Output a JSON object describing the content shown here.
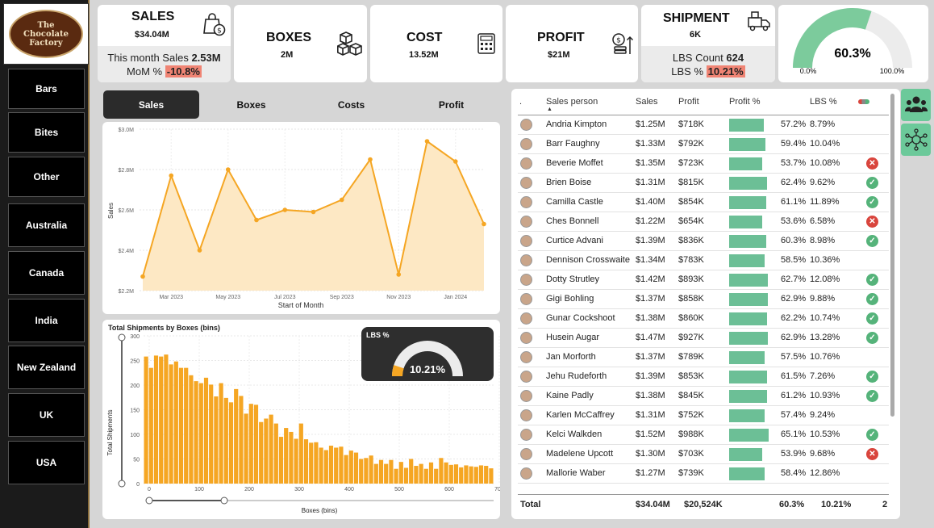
{
  "logo": {
    "line1": "The",
    "line2": "Chocolate",
    "line3": "Factory"
  },
  "nav": [
    "Bars",
    "Bites",
    "Other",
    "Australia",
    "Canada",
    "India",
    "New Zealand",
    "UK",
    "USA"
  ],
  "kpi": {
    "sales": {
      "title": "SALES",
      "value": "$34.04M",
      "month_label": "This month Sales",
      "month_value": "2.53M",
      "mom_label": "MoM %",
      "mom_value": "-10.8%"
    },
    "boxes": {
      "title": "BOXES",
      "value": "2M"
    },
    "cost": {
      "title": "COST",
      "value": "13.52M"
    },
    "profit": {
      "title": "PROFIT",
      "value": "$21M"
    },
    "shipment": {
      "title": "SHIPMENT",
      "value": "6K",
      "lbs_count_label": "LBS Count",
      "lbs_count_value": "624",
      "lbs_pct_label": "LBS %",
      "lbs_pct_value": "10.21%"
    },
    "gauge": {
      "value": "60.3%",
      "min": "0.0%",
      "max": "100.0%",
      "fraction": 0.603
    }
  },
  "tabs": [
    "Sales",
    "Boxes",
    "Costs",
    "Profit"
  ],
  "colors": {
    "accent": "#f5a623",
    "area": "#fde8c4",
    "green": "#6cbf96",
    "red": "#f08474"
  },
  "chart_data": [
    {
      "type": "area",
      "xlabel": "Start of Month",
      "ylabel": "Sales",
      "ylim": [
        2.2,
        3.0
      ],
      "y_ticks": [
        "$2.2M",
        "$2.4M",
        "$2.6M",
        "$2.8M",
        "$3.0M"
      ],
      "x_ticks": [
        "Mar 2023",
        "May 2023",
        "Jul 2023",
        "Sep 2023",
        "Nov 2023",
        "Jan 2024"
      ],
      "x": [
        "Feb 2023",
        "Mar 2023",
        "Apr 2023",
        "May 2023",
        "Jun 2023",
        "Jul 2023",
        "Aug 2023",
        "Sep 2023",
        "Oct 2023",
        "Nov 2023",
        "Dec 2023",
        "Jan 2024",
        "Feb 2024"
      ],
      "values": [
        2.27,
        2.77,
        2.4,
        2.8,
        2.55,
        2.6,
        2.59,
        2.65,
        2.85,
        2.28,
        2.94,
        2.84,
        2.53
      ]
    },
    {
      "type": "bar",
      "title": "Total Shipments by Boxes (bins)",
      "xlabel": "Boxes (bins)",
      "ylabel": "Total Shipments",
      "ylim": [
        0,
        300
      ],
      "y_ticks": [
        "0",
        "50",
        "100",
        "150",
        "200",
        "250",
        "300"
      ],
      "x_ticks": [
        "0",
        "100",
        "200",
        "300",
        "400",
        "500",
        "600",
        "700"
      ],
      "bin_width": 10,
      "values": [
        258,
        235,
        260,
        258,
        262,
        242,
        248,
        235,
        235,
        220,
        208,
        204,
        215,
        201,
        177,
        204,
        174,
        165,
        192,
        178,
        142,
        162,
        160,
        125,
        132,
        140,
        122,
        95,
        113,
        105,
        91,
        122,
        90,
        83,
        84,
        73,
        68,
        77,
        73,
        75,
        58,
        67,
        63,
        50,
        52,
        57,
        40,
        48,
        40,
        48,
        30,
        44,
        32,
        50,
        36,
        40,
        30,
        43,
        30,
        52,
        43,
        38,
        39,
        33,
        37,
        35,
        34,
        37,
        36,
        31
      ]
    },
    {
      "type": "gauge",
      "title": "LBS %",
      "value": "10.21%",
      "fraction": 0.1021
    }
  ],
  "table": {
    "headers": {
      "sales_person": "Sales person",
      "sales": "Sales",
      "profit": "Profit",
      "profit_pct": "Profit %",
      "lbs_pct": "LBS %"
    },
    "rows": [
      {
        "name": "Andria Kimpton",
        "sales": "$1.25M",
        "profit": "$718K",
        "profit_pct": "57.2%",
        "pct": 0.572,
        "lbs": "8.79%",
        "status": ""
      },
      {
        "name": "Barr Faughny",
        "sales": "$1.33M",
        "profit": "$792K",
        "profit_pct": "59.4%",
        "pct": 0.594,
        "lbs": "10.04%",
        "status": ""
      },
      {
        "name": "Beverie Moffet",
        "sales": "$1.35M",
        "profit": "$723K",
        "profit_pct": "53.7%",
        "pct": 0.537,
        "lbs": "10.08%",
        "status": "bad"
      },
      {
        "name": "Brien Boise",
        "sales": "$1.31M",
        "profit": "$815K",
        "profit_pct": "62.4%",
        "pct": 0.624,
        "lbs": "9.62%",
        "status": "ok"
      },
      {
        "name": "Camilla Castle",
        "sales": "$1.40M",
        "profit": "$854K",
        "profit_pct": "61.1%",
        "pct": 0.611,
        "lbs": "11.89%",
        "status": "ok"
      },
      {
        "name": "Ches Bonnell",
        "sales": "$1.22M",
        "profit": "$654K",
        "profit_pct": "53.6%",
        "pct": 0.536,
        "lbs": "6.58%",
        "status": "bad"
      },
      {
        "name": "Curtice Advani",
        "sales": "$1.39M",
        "profit": "$836K",
        "profit_pct": "60.3%",
        "pct": 0.603,
        "lbs": "8.98%",
        "status": "ok"
      },
      {
        "name": "Dennison Crosswaite",
        "sales": "$1.34M",
        "profit": "$783K",
        "profit_pct": "58.5%",
        "pct": 0.585,
        "lbs": "10.36%",
        "status": ""
      },
      {
        "name": "Dotty Strutley",
        "sales": "$1.42M",
        "profit": "$893K",
        "profit_pct": "62.7%",
        "pct": 0.627,
        "lbs": "12.08%",
        "status": "ok"
      },
      {
        "name": "Gigi Bohling",
        "sales": "$1.37M",
        "profit": "$858K",
        "profit_pct": "62.9%",
        "pct": 0.629,
        "lbs": "9.88%",
        "status": "ok"
      },
      {
        "name": "Gunar Cockshoot",
        "sales": "$1.38M",
        "profit": "$860K",
        "profit_pct": "62.2%",
        "pct": 0.622,
        "lbs": "10.74%",
        "status": "ok"
      },
      {
        "name": "Husein Augar",
        "sales": "$1.47M",
        "profit": "$927K",
        "profit_pct": "62.9%",
        "pct": 0.629,
        "lbs": "13.28%",
        "status": "ok"
      },
      {
        "name": "Jan Morforth",
        "sales": "$1.37M",
        "profit": "$789K",
        "profit_pct": "57.5%",
        "pct": 0.575,
        "lbs": "10.76%",
        "status": ""
      },
      {
        "name": "Jehu Rudeforth",
        "sales": "$1.39M",
        "profit": "$853K",
        "profit_pct": "61.5%",
        "pct": 0.615,
        "lbs": "7.26%",
        "status": "ok"
      },
      {
        "name": "Kaine Padly",
        "sales": "$1.38M",
        "profit": "$845K",
        "profit_pct": "61.2%",
        "pct": 0.612,
        "lbs": "10.93%",
        "status": "ok"
      },
      {
        "name": "Karlen McCaffrey",
        "sales": "$1.31M",
        "profit": "$752K",
        "profit_pct": "57.4%",
        "pct": 0.574,
        "lbs": "9.24%",
        "status": ""
      },
      {
        "name": "Kelci Walkden",
        "sales": "$1.52M",
        "profit": "$988K",
        "profit_pct": "65.1%",
        "pct": 0.651,
        "lbs": "10.53%",
        "status": "ok"
      },
      {
        "name": "Madelene Upcott",
        "sales": "$1.30M",
        "profit": "$703K",
        "profit_pct": "53.9%",
        "pct": 0.539,
        "lbs": "9.68%",
        "status": "bad"
      },
      {
        "name": "Mallorie Waber",
        "sales": "$1.27M",
        "profit": "$739K",
        "profit_pct": "58.4%",
        "pct": 0.584,
        "lbs": "12.86%",
        "status": ""
      }
    ],
    "total": {
      "label": "Total",
      "sales": "$34.04M",
      "profit": "$20,524K",
      "profit_pct": "60.3%",
      "lbs": "10.21%",
      "count": "2"
    }
  },
  "icons": {
    "bag": "shopping-bag-icon",
    "boxes": "boxes-icon",
    "cost": "calculator-icon",
    "profit": "coins-icon",
    "truck": "delivery-truck-icon",
    "people": "people-icon",
    "network": "network-icon"
  }
}
